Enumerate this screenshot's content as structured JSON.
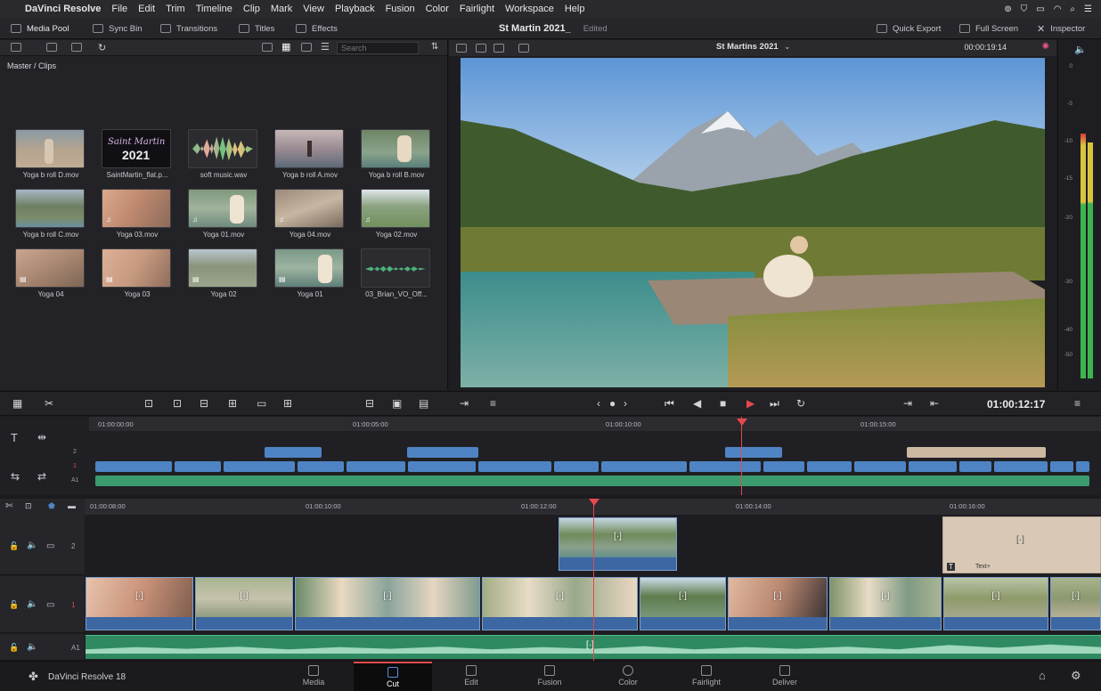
{
  "menubar": {
    "app_name": "DaVinci Resolve",
    "items": [
      "File",
      "Edit",
      "Trim",
      "Timeline",
      "Clip",
      "Mark",
      "View",
      "Playback",
      "Fusion",
      "Color",
      "Fairlight",
      "Workspace",
      "Help"
    ]
  },
  "toolbar": {
    "media_pool": "Media Pool",
    "sync_bin": "Sync Bin",
    "transitions": "Transitions",
    "titles": "Titles",
    "effects": "Effects",
    "project_name": "St Martin 2021_",
    "project_state": "Edited",
    "quick_export": "Quick Export",
    "full_screen": "Full Screen",
    "inspector": "Inspector"
  },
  "media_pool": {
    "search_placeholder": "Search",
    "breadcrumb": "Master / Clips",
    "clips": [
      {
        "label": "Yoga b roll D.mov",
        "kind": "video"
      },
      {
        "label": "SaintMartin_flat.p...",
        "kind": "graphic"
      },
      {
        "label": "soft music.wav",
        "kind": "audio"
      },
      {
        "label": "Yoga b roll A.mov",
        "kind": "video"
      },
      {
        "label": "Yoga b roll B.mov",
        "kind": "video"
      },
      {
        "label": "Yoga b roll C.mov",
        "kind": "video"
      },
      {
        "label": "Yoga 03.mov",
        "kind": "video"
      },
      {
        "label": "Yoga 01.mov",
        "kind": "video"
      },
      {
        "label": "Yoga 04.mov",
        "kind": "video"
      },
      {
        "label": "Yoga 02.mov",
        "kind": "video"
      },
      {
        "label": "Yoga 04",
        "kind": "timeline"
      },
      {
        "label": "Yoga 03",
        "kind": "timeline"
      },
      {
        "label": "Yoga 02",
        "kind": "timeline"
      },
      {
        "label": "Yoga 01",
        "kind": "timeline"
      },
      {
        "label": "03_Brian_VO_Off...",
        "kind": "audio"
      }
    ],
    "graphic_text_top": "Saint Martin",
    "graphic_text_year": "2021"
  },
  "viewer": {
    "timeline_name": "St Martins 2021",
    "source_timecode": "00:00:19:14",
    "record_timecode": "01:00:12:17"
  },
  "meter": {
    "ticks": [
      "0",
      "-5",
      "-10",
      "-15",
      "-20",
      "-30",
      "-40",
      "-50"
    ]
  },
  "upper_timeline": {
    "ruler": [
      "01:00:00:00",
      "01:00:05:00",
      "01:00:10:00",
      "01:00:15:00"
    ],
    "track_labels": [
      "2",
      "1",
      "A1"
    ]
  },
  "lower_timeline": {
    "ruler": [
      "01:00:08:00",
      "01:00:10:00",
      "01:00:12:00",
      "01:00:14:00",
      "01:00:16:00"
    ],
    "tracks": [
      {
        "name": "2"
      },
      {
        "name": "1"
      },
      {
        "name": "A1"
      }
    ],
    "title_clip_label": "Text+"
  },
  "pages": [
    {
      "label": "Media",
      "active": false
    },
    {
      "label": "Cut",
      "active": true
    },
    {
      "label": "Edit",
      "active": false
    },
    {
      "label": "Fusion",
      "active": false
    },
    {
      "label": "Color",
      "active": false
    },
    {
      "label": "Fairlight",
      "active": false
    },
    {
      "label": "Deliver",
      "active": false
    }
  ],
  "footer": {
    "product": "DaVinci Resolve 18"
  },
  "colors": {
    "accent_red": "#e5484d",
    "clip_blue": "#4f7cb8",
    "audio_green": "#3a9b6e",
    "title_tan": "#cdb8a2"
  }
}
